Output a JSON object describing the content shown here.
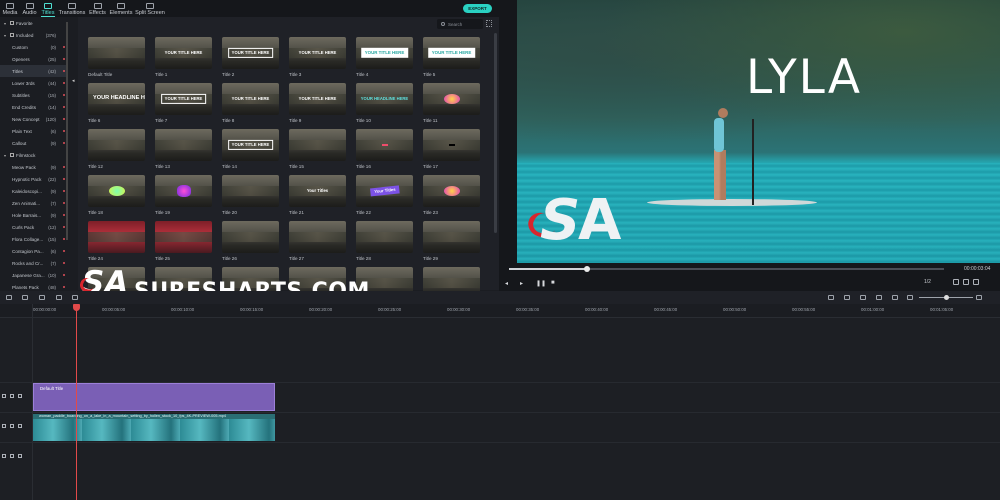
{
  "tabs": [
    {
      "label": "Media",
      "active": false
    },
    {
      "label": "Audio",
      "active": false
    },
    {
      "label": "Titles",
      "active": true
    },
    {
      "label": "Transitions",
      "active": false
    },
    {
      "label": "Effects",
      "active": false
    },
    {
      "label": "Elements",
      "active": false
    },
    {
      "label": "Split Screen",
      "active": false
    }
  ],
  "export_label": "EXPORT",
  "search_placeholder": "Search",
  "sidebar": {
    "items": [
      {
        "label": "Favorite",
        "count": "",
        "type": "grp"
      },
      {
        "label": "Included",
        "count": "(376)",
        "type": "grp"
      },
      {
        "label": "Custom",
        "count": "(0)",
        "type": "item"
      },
      {
        "label": "Openers",
        "count": "(25)",
        "type": "item"
      },
      {
        "label": "Titles",
        "count": "(42)",
        "type": "item",
        "active": true
      },
      {
        "label": "Lower 3rds",
        "count": "(44)",
        "type": "item"
      },
      {
        "label": "Subtitles",
        "count": "(15)",
        "type": "item"
      },
      {
        "label": "End Credits",
        "count": "(14)",
        "type": "item"
      },
      {
        "label": "New Concept",
        "count": "(120)",
        "type": "item"
      },
      {
        "label": "Plain Text",
        "count": "(6)",
        "type": "item"
      },
      {
        "label": "Callout",
        "count": "(9)",
        "type": "item"
      },
      {
        "label": "Filmstock",
        "count": "",
        "type": "grp"
      },
      {
        "label": "Meow Pack",
        "count": "(9)",
        "type": "item"
      },
      {
        "label": "Hypnotic Pack",
        "count": "(22)",
        "type": "item"
      },
      {
        "label": "Kaleidoscopi...",
        "count": "(9)",
        "type": "item"
      },
      {
        "label": "Zen Animati...",
        "count": "(7)",
        "type": "item"
      },
      {
        "label": "Hole Barrais...",
        "count": "(9)",
        "type": "item"
      },
      {
        "label": "Curls Pack",
        "count": "(12)",
        "type": "item"
      },
      {
        "label": "Flora Collage...",
        "count": "(15)",
        "type": "item"
      },
      {
        "label": "Contagion Pa...",
        "count": "(6)",
        "type": "item"
      },
      {
        "label": "Rocks and Cr...",
        "count": "(7)",
        "type": "item"
      },
      {
        "label": "Japanese Gra...",
        "count": "(10)",
        "type": "item"
      },
      {
        "label": "Planets Pack",
        "count": "(48)",
        "type": "item"
      }
    ]
  },
  "titles": [
    {
      "label": "Default Title",
      "ov": "",
      "style": ""
    },
    {
      "label": "Title 1",
      "ov": "YOUR TITLE HERE",
      "style": "plain"
    },
    {
      "label": "Title 2",
      "ov": "YOUR TITLE HERE",
      "style": "box"
    },
    {
      "label": "Title 3",
      "ov": "YOUR TITLE HERE",
      "style": "plain"
    },
    {
      "label": "Title 4",
      "ov": "YOUR TITLE HERE",
      "style": "white"
    },
    {
      "label": "Title 5",
      "ov": "YOUR TITLE HERE",
      "style": "white"
    },
    {
      "label": "Title 6",
      "ov": "YOUR HEADLINE HERE",
      "style": "big"
    },
    {
      "label": "Title 7",
      "ov": "YOUR TITLE HERE",
      "style": "box"
    },
    {
      "label": "Title 8",
      "ov": "YOUR TITLE HERE",
      "style": "plain"
    },
    {
      "label": "Title 9",
      "ov": "YOUR TITLE HERE",
      "style": "plain"
    },
    {
      "label": "Title 10",
      "ov": "YOUR HEADLINE HERE",
      "style": "teal"
    },
    {
      "label": "Title 11",
      "ov": "",
      "style": "blob"
    },
    {
      "label": "Title 12",
      "ov": "",
      "style": "plain"
    },
    {
      "label": "Title 13",
      "ov": "",
      "style": "plain"
    },
    {
      "label": "Title 14",
      "ov": "YOUR TITLE HERE",
      "style": "box"
    },
    {
      "label": "Title 15",
      "ov": "",
      "style": "plain"
    },
    {
      "label": "Title 16",
      "ov": "",
      "style": "pink"
    },
    {
      "label": "Title 17",
      "ov": "",
      "style": "dark"
    },
    {
      "label": "Title 18",
      "ov": "",
      "style": "blob3"
    },
    {
      "label": "Title 19",
      "ov": "",
      "style": "blob2"
    },
    {
      "label": "Title 20",
      "ov": "",
      "style": "plain"
    },
    {
      "label": "Title 21",
      "ov": "Your Titles",
      "style": "plain"
    },
    {
      "label": "Title 22",
      "ov": "Your Titles",
      "style": "ribbon"
    },
    {
      "label": "Title 23",
      "ov": "",
      "style": "blob"
    },
    {
      "label": "Title 24",
      "ov": "",
      "style": "red"
    },
    {
      "label": "Title 25",
      "ov": "",
      "style": "red"
    },
    {
      "label": "Title 26",
      "ov": "",
      "style": "plain"
    },
    {
      "label": "Title 27",
      "ov": "",
      "style": "plain"
    },
    {
      "label": "Title 28",
      "ov": "",
      "style": "plain"
    },
    {
      "label": "Title 29",
      "ov": "",
      "style": "plain"
    },
    {
      "label": "",
      "ov": "",
      "style": "plain"
    },
    {
      "label": "",
      "ov": "",
      "style": "plain"
    },
    {
      "label": "",
      "ov": "",
      "style": "plain"
    },
    {
      "label": "",
      "ov": "",
      "style": "plain"
    },
    {
      "label": "",
      "ov": "",
      "style": "plain"
    },
    {
      "label": "",
      "ov": "",
      "style": "plain"
    }
  ],
  "preview": {
    "overlay_text": "LYLA",
    "timecode": "00:00:03:04",
    "quality": "1/2",
    "progress": 0.18
  },
  "watermark": {
    "logo": "SA",
    "text": "SURESHARTS.COM"
  },
  "ruler": [
    "00:00:00:00",
    "00:00:05:00",
    "00:00:10:00",
    "00:00:15:00",
    "00:00:20:00",
    "00:00:25:00",
    "00:00:30:00",
    "00:00:35:00",
    "00:00:40:00",
    "00:00:45:00",
    "00:00:50:00",
    "00:00:55:00",
    "00:01:00:00",
    "00:01:05:00"
  ],
  "timeline": {
    "title_clip": "Default Title",
    "video_clip": "woman_paddle_boarding_on_a_lake_in_a_mountain_setting_by_hollen_stock_10_fps_4K-PREVIEW-005.mp4"
  },
  "colors": {
    "accent": "#2ad1c2",
    "playhead": "#e24a4a",
    "title_clip": "#7a5fb5"
  }
}
